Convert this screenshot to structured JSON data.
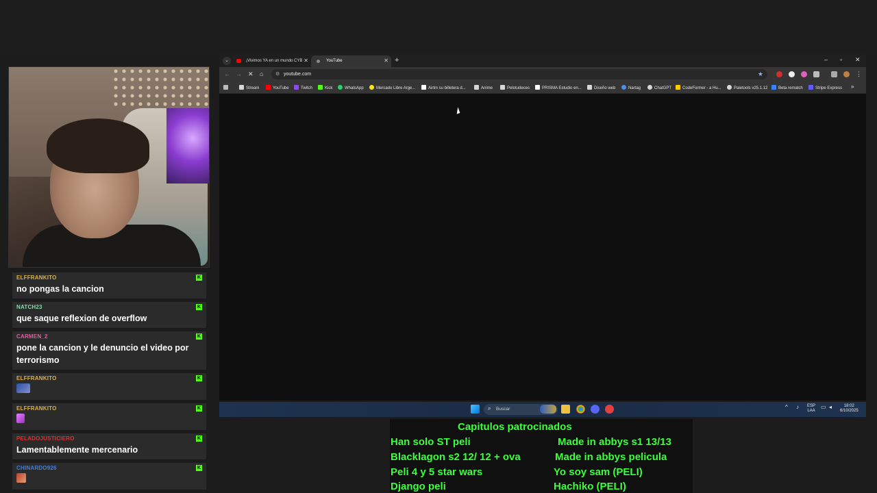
{
  "browser": {
    "tabs": [
      {
        "label": "¡Vivimos YA en un mundo CYB",
        "active": false
      },
      {
        "label": "YouTube",
        "active": true
      }
    ],
    "address": "youtube.com",
    "bookmarks": [
      {
        "label": "Stream",
        "icon": "folder-icon",
        "color": "#d7d7d7"
      },
      {
        "label": "YouTube",
        "icon": "youtube-icon",
        "color": "#ff0000"
      },
      {
        "label": "Twitch",
        "icon": "twitch-icon",
        "color": "#9146ff"
      },
      {
        "label": "Kick",
        "icon": "kick-icon",
        "color": "#53fc18"
      },
      {
        "label": "WhatsApp",
        "icon": "whatsapp-icon",
        "color": "#25d366"
      },
      {
        "label": "Mercado Libre Arge...",
        "icon": "mercadolibre-icon",
        "color": "#ffe600"
      },
      {
        "label": "Airtm su billetera d...",
        "icon": "airtm-icon",
        "color": "#ffffff"
      },
      {
        "label": "Anime",
        "icon": "folder-icon",
        "color": "#d7d7d7"
      },
      {
        "label": "Pelotudeces",
        "icon": "folder-icon",
        "color": "#d7d7d7"
      },
      {
        "label": "PRISMA Estudio en...",
        "icon": "prisma-icon",
        "color": "#ffffff"
      },
      {
        "label": "Diseño web",
        "icon": "folder-icon",
        "color": "#d7d7d7"
      },
      {
        "label": "Nartag",
        "icon": "wordpress-icon",
        "color": "#4a90e2"
      },
      {
        "label": "ChatGPT",
        "icon": "chatgpt-icon",
        "color": "#d7d7d7"
      },
      {
        "label": "CodeFormer - a Hu...",
        "icon": "codeformer-icon",
        "color": "#ffcc00"
      },
      {
        "label": "Paletools v25.1.12",
        "icon": "paletools-icon",
        "color": "#d7d7d7"
      },
      {
        "label": "Beta rematch",
        "icon": "rematch-icon",
        "color": "#3b82f6"
      },
      {
        "label": "Stripe Express",
        "icon": "stripe-icon",
        "color": "#635bff"
      }
    ]
  },
  "chat": {
    "messages": [
      {
        "user": "ELFFRANKITO",
        "color": "#e0b240",
        "text": "no pongas la cancion"
      },
      {
        "user": "NATCH23",
        "color": "#7de0a8",
        "text": "que saque reflexion de overflow"
      },
      {
        "user": "CARMEN_2",
        "color": "#e060a0",
        "text": "pone la cancion y le denuncio el video por terrorismo"
      },
      {
        "user": "ELFFRANKITO",
        "color": "#e0b240",
        "text": ""
      },
      {
        "user": "ELFFRANKITO",
        "color": "#e0b240",
        "text": ""
      },
      {
        "user": "PELADOJUSTICIERO",
        "color": "#e03030",
        "text": "Lamentablemente mercenario"
      },
      {
        "user": "CHINARDO926",
        "color": "#4080e0",
        "text": ""
      }
    ]
  },
  "taskbar": {
    "search_placeholder": "Buscar",
    "lang_top": "ESP",
    "lang_bottom": "LAA",
    "time": "18:02",
    "date": "6/10/2025"
  },
  "overlay": {
    "title": "Capitulos patrocinados",
    "left": [
      "Han solo ST peli",
      "Blacklagon s2 12/ 12 + ova",
      "Peli 4  y 5 star wars",
      "Django peli"
    ],
    "right": [
      "Made in abbys s1 13/13",
      "Made in abbys pelicula",
      "Yo soy sam (PELI)",
      "Hachiko (PELI)"
    ]
  }
}
